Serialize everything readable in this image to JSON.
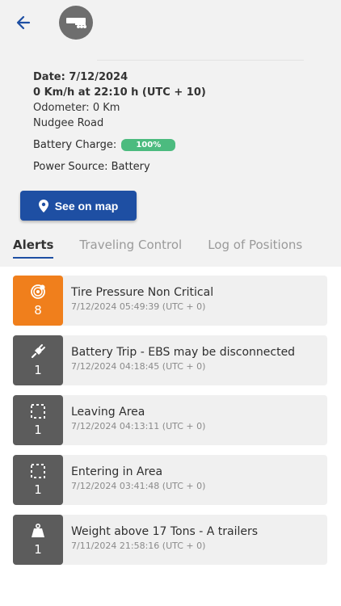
{
  "header": {
    "back_icon": "arrow-left-icon",
    "avatar_icon": "trailer-icon"
  },
  "info": {
    "date": "Date: 7/12/2024",
    "speed": "0 Km/h at 22:10 h (UTC + 10)",
    "odometer": "Odometer: 0 Km",
    "location": "Nudgee Road",
    "battery_label": "Battery Charge:",
    "battery_value": "100%",
    "power_source": "Power Source: Battery"
  },
  "map_button": {
    "label": "See on map",
    "icon": "map-pin-icon"
  },
  "tabs": [
    {
      "label": "Alerts",
      "active": true
    },
    {
      "label": "Traveling Control",
      "active": false
    },
    {
      "label": "Log of Positions",
      "active": false
    }
  ],
  "alerts": [
    {
      "title": "Tire Pressure Non Critical",
      "time": "7/12/2024 05:49:39 (UTC + 0)",
      "count": "8",
      "icon": "tire-pressure-icon",
      "color": "#f07f1c"
    },
    {
      "title": "Battery Trip - EBS may be disconnected",
      "time": "7/12/2024 04:18:45 (UTC + 0)",
      "count": "1",
      "icon": "plug-icon",
      "color": "#5c5c5c"
    },
    {
      "title": "Leaving Area",
      "time": "7/12/2024 04:13:11 (UTC + 0)",
      "count": "1",
      "icon": "area-icon",
      "color": "#5c5c5c"
    },
    {
      "title": "Entering in Area",
      "time": "7/12/2024 03:41:48 (UTC + 0)",
      "count": "1",
      "icon": "area-icon",
      "color": "#5c5c5c"
    },
    {
      "title": "Weight above 17 Tons - A trailers",
      "time": "7/11/2024 21:58:16 (UTC + 0)",
      "count": "1",
      "icon": "weight-icon",
      "color": "#5c5c5c"
    }
  ],
  "colors": {
    "accent": "#1e4fa3",
    "battery_badge": "#4cbb7f",
    "alert_orange": "#f07f1c",
    "alert_gray": "#5c5c5c"
  }
}
